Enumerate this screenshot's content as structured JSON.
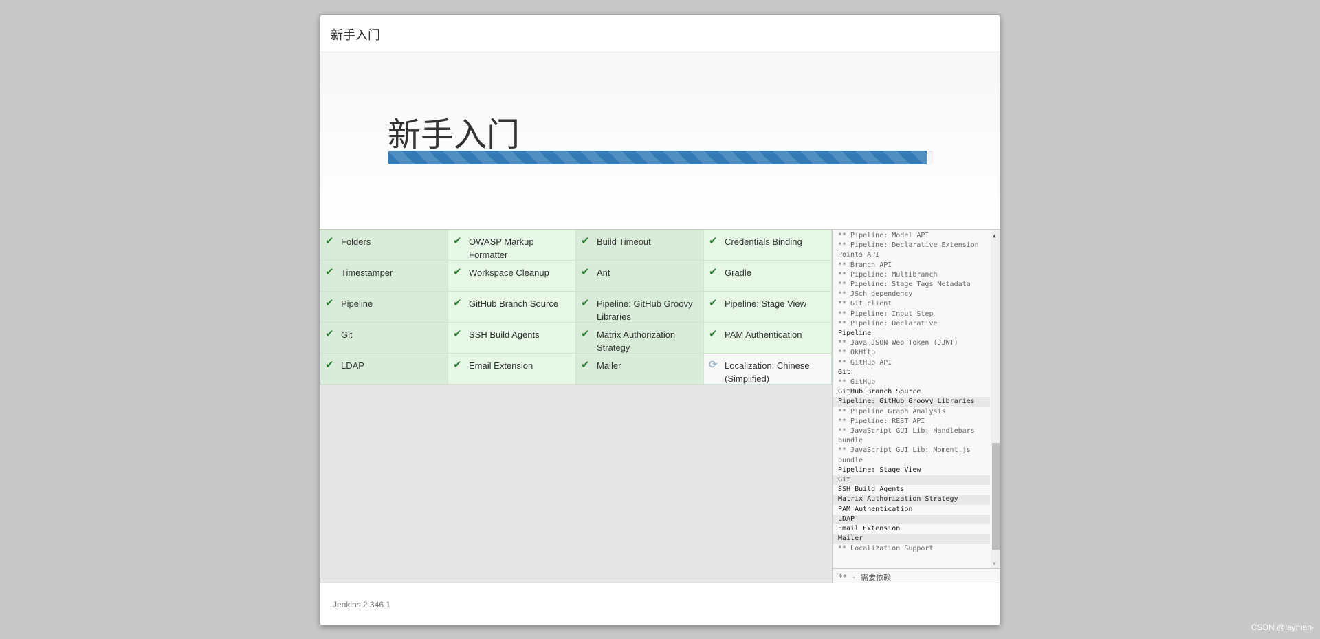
{
  "header": {
    "title": "新手入门"
  },
  "hero": {
    "title": "新手入门",
    "progress_percent": 98.9
  },
  "plugins": [
    {
      "name": "Folders",
      "status": "done"
    },
    {
      "name": "OWASP Markup Formatter",
      "status": "done"
    },
    {
      "name": "Build Timeout",
      "status": "done"
    },
    {
      "name": "Credentials Binding",
      "status": "done"
    },
    {
      "name": "Timestamper",
      "status": "done"
    },
    {
      "name": "Workspace Cleanup",
      "status": "done"
    },
    {
      "name": "Ant",
      "status": "done"
    },
    {
      "name": "Gradle",
      "status": "done"
    },
    {
      "name": "Pipeline",
      "status": "done"
    },
    {
      "name": "GitHub Branch Source",
      "status": "done"
    },
    {
      "name": "Pipeline: GitHub Groovy Libraries",
      "status": "done"
    },
    {
      "name": "Pipeline: Stage View",
      "status": "done"
    },
    {
      "name": "Git",
      "status": "done"
    },
    {
      "name": "SSH Build Agents",
      "status": "done"
    },
    {
      "name": "Matrix Authorization Strategy",
      "status": "done"
    },
    {
      "name": "PAM Authentication",
      "status": "done"
    },
    {
      "name": "LDAP",
      "status": "done"
    },
    {
      "name": "Email Extension",
      "status": "done"
    },
    {
      "name": "Mailer",
      "status": "done"
    },
    {
      "name": "Localization: Chinese (Simplified)",
      "status": "installing"
    }
  ],
  "log": [
    {
      "t": "** Pipeline: Model API",
      "dep": true
    },
    {
      "t": "** Pipeline: Declarative Extension Points API",
      "dep": true
    },
    {
      "t": "** Branch API",
      "dep": true
    },
    {
      "t": "** Pipeline: Multibranch",
      "dep": true
    },
    {
      "t": "** Pipeline: Stage Tags Metadata",
      "dep": true
    },
    {
      "t": "** JSch dependency",
      "dep": true
    },
    {
      "t": "** Git client",
      "dep": true
    },
    {
      "t": "** Pipeline: Input Step",
      "dep": true
    },
    {
      "t": "** Pipeline: Declarative",
      "dep": true
    },
    {
      "t": "Pipeline",
      "dep": false
    },
    {
      "t": "** Java JSON Web Token (JJWT)",
      "dep": true
    },
    {
      "t": "** OkHttp",
      "dep": true
    },
    {
      "t": "** GitHub API",
      "dep": true
    },
    {
      "t": "Git",
      "dep": false
    },
    {
      "t": "** GitHub",
      "dep": true
    },
    {
      "t": "GitHub Branch Source",
      "dep": false
    },
    {
      "t": "Pipeline: GitHub Groovy Libraries",
      "dep": false,
      "alt": true
    },
    {
      "t": "** Pipeline Graph Analysis",
      "dep": true
    },
    {
      "t": "** Pipeline: REST API",
      "dep": true
    },
    {
      "t": "** JavaScript GUI Lib: Handlebars bundle",
      "dep": true
    },
    {
      "t": "** JavaScript GUI Lib: Moment.js bundle",
      "dep": true
    },
    {
      "t": "Pipeline: Stage View",
      "dep": false
    },
    {
      "t": "Git",
      "dep": false,
      "alt": true
    },
    {
      "t": "SSH Build Agents",
      "dep": false
    },
    {
      "t": "Matrix Authorization Strategy",
      "dep": false,
      "alt": true
    },
    {
      "t": "PAM Authentication",
      "dep": false
    },
    {
      "t": "LDAP",
      "dep": false,
      "alt": true
    },
    {
      "t": "Email Extension",
      "dep": false
    },
    {
      "t": "Mailer",
      "dep": false,
      "alt": true
    },
    {
      "t": "** Localization Support",
      "dep": true
    }
  ],
  "legend": "** - 需要依赖",
  "footer": {
    "version": "Jenkins 2.346.1"
  },
  "watermark": "CSDN @layman-",
  "colors": {
    "progress": "#337ab7",
    "check": "#2e7d32"
  }
}
